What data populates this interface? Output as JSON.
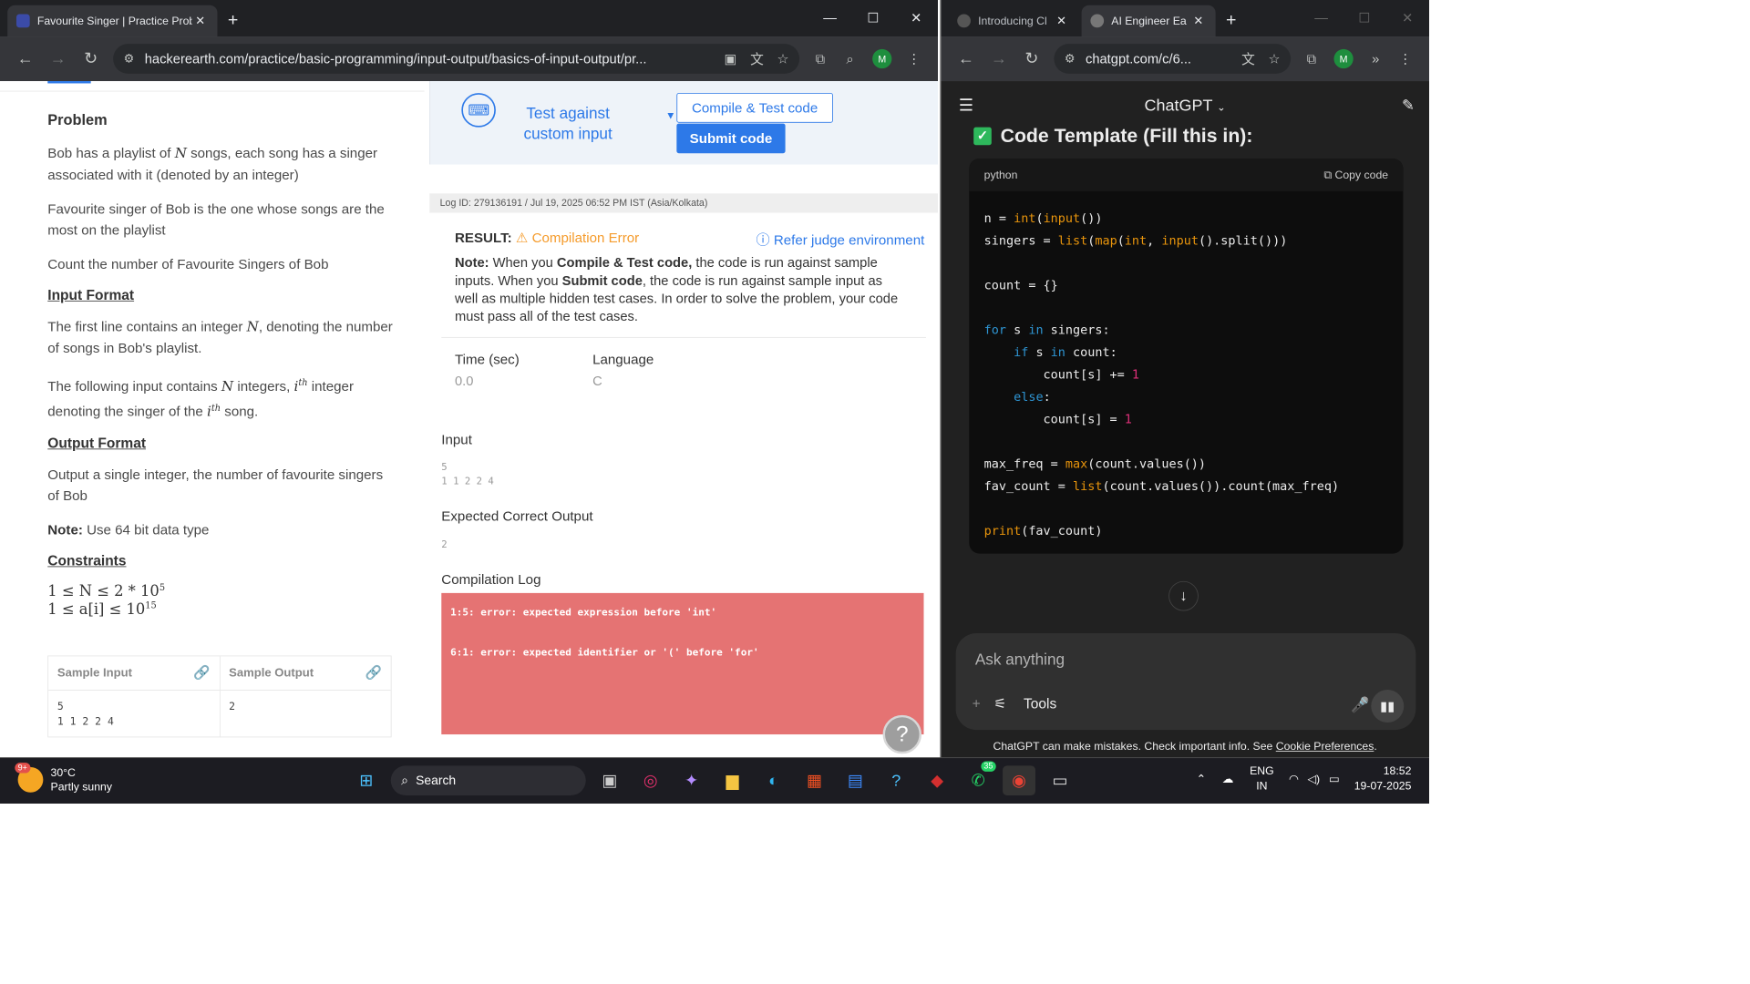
{
  "left_browser": {
    "tabs": [
      {
        "title": "Favourite Singer | Practice Probl"
      }
    ],
    "url": "hackerearth.com/practice/basic-programming/input-output/basics-of-input-output/pr...",
    "profile_initial": "M"
  },
  "problem": {
    "heading": "Problem",
    "p1a": "Bob has a playlist of ",
    "p1var": "N",
    "p1b": " songs, each song has a singer associated with it (denoted by an integer)",
    "p2": "Favourite singer of Bob is the one whose songs are the most on the playlist",
    "p3": "Count the number of Favourite Singers of Bob",
    "input_format_heading": "Input Format",
    "in1a": "The first line contains an integer ",
    "in1var": "N",
    "in1b": ", denoting the number of songs in Bob's playlist.",
    "in2a": "The following input contains ",
    "in2var": "N",
    "in2b": " integers, ",
    "in2ith": "i",
    "in2sup": "th",
    "in2c": " integer denoting the singer of the ",
    "in2ith2": "i",
    "in2sup2": "th",
    "in2d": " song.",
    "output_format_heading": "Output Format",
    "out1": "Output a single integer, the number of favourite singers of Bob",
    "note_label": "Note:",
    "note_text": " Use 64 bit data type",
    "constraints_heading": "Constraints",
    "c1": "1 ≤ N ≤ 2 * 10",
    "c1sup": "5",
    "c2": "1 ≤ a[i] ≤ 10",
    "c2sup": "15",
    "sample_input_label": "Sample Input",
    "sample_output_label": "Sample Output",
    "sample_input": "5\n1 1 2 2 4",
    "sample_output": "2"
  },
  "runbar": {
    "custom_label": "Test against custom input",
    "compile_btn": "Compile & Test code",
    "submit_btn": "Submit code"
  },
  "result": {
    "log_id": "Log ID: 279136191 / Jul 19, 2025 06:52 PM IST (Asia/Kolkata)",
    "result_label": "RESULT:",
    "status": "Compilation Error",
    "refer": "Refer judge environment",
    "note_label": "Note:",
    "note_a": " When you ",
    "compile_bold": "Compile & Test code,",
    "note_b": " the code is run against sample inputs. When you ",
    "submit_bold": "Submit code",
    "note_c": ", the code is run against sample input as well as multiple hidden test cases. In order to solve the problem, your code must pass all of the test cases.",
    "time_label": "Time (sec)",
    "time_value": "0.0",
    "lang_label": "Language",
    "lang_value": "C",
    "input_label": "Input",
    "input_value": "5\n1 1 2 2 4",
    "expected_label": "Expected Correct Output",
    "expected_value": "2",
    "log_label": "Compilation Log",
    "err1": "1:5: error: expected expression before 'int'",
    "err2": "6:1: error: expected identifier or '(' before 'for'"
  },
  "right_browser": {
    "tabs": [
      {
        "title": "Introducing Cl"
      },
      {
        "title": "AI Engineer Ea"
      }
    ],
    "url": "chatgpt.com/c/6...",
    "profile_initial": "M"
  },
  "chatgpt": {
    "model_label": "ChatGPT",
    "heading": "Code Template (Fill this in):",
    "code_lang": "python",
    "copy_label": "Copy code",
    "placeholder": "Ask anything",
    "tools_label": "Tools",
    "disclaimer": "ChatGPT can make mistakes. Check important info. See ",
    "cookie_link": "Cookie Preferences",
    "disclaimer_end": "."
  },
  "taskbar": {
    "weather_badge": "9+",
    "temp": "30°C",
    "weather": "Partly sunny",
    "search_label": "Search",
    "whatsapp_badge": "35",
    "lang1": "ENG",
    "lang2": "IN",
    "time": "18:52",
    "date": "19-07-2025"
  }
}
